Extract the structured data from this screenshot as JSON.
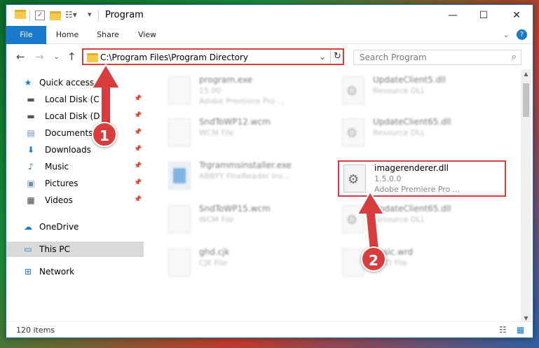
{
  "window": {
    "title": "Program",
    "minimize": "—",
    "maximize": "☐",
    "close": "✕"
  },
  "ribbon": {
    "tabs": [
      "File",
      "Home",
      "Share",
      "View"
    ],
    "expand": "⌄",
    "help": "?"
  },
  "nav": {
    "back": "←",
    "forward": "→",
    "recent": "⌄",
    "up": "↑",
    "address": "C:\\Program Files\\Program Directory",
    "address_chevron": "⌄",
    "refresh": "↻",
    "search_placeholder": "Search Program",
    "search_icon": "⌕"
  },
  "sidebar": {
    "items": [
      {
        "label": "Quick access",
        "icon": "star-icon",
        "glyph": "★"
      },
      {
        "label": "Local Disk (C:)",
        "icon": "drive-icon",
        "glyph": "▬"
      },
      {
        "label": "Local Disk (D:)",
        "icon": "drive-icon",
        "glyph": "▬"
      },
      {
        "label": "Documents",
        "icon": "documents-icon",
        "glyph": "▤"
      },
      {
        "label": "Downloads",
        "icon": "download-icon",
        "glyph": "⬇"
      },
      {
        "label": "Music",
        "icon": "music-icon",
        "glyph": "♪"
      },
      {
        "label": "Pictures",
        "icon": "pictures-icon",
        "glyph": "▣"
      },
      {
        "label": "Videos",
        "icon": "video-icon",
        "glyph": "▦"
      },
      {
        "label": "OneDrive",
        "icon": "cloud-icon",
        "glyph": "☁"
      },
      {
        "label": "This PC",
        "icon": "computer-icon",
        "glyph": "▭"
      },
      {
        "label": "Network",
        "icon": "network-icon",
        "glyph": "⊞"
      }
    ],
    "pin": "📌"
  },
  "files": [
    {
      "name": "program.exe",
      "line1": "15.00",
      "line2": "Adobe Premiere Pro ..."
    },
    {
      "name": "UpdateClient5.dll",
      "line1": "Resource DLL",
      "line2": ""
    },
    {
      "name": "SndToWP12.wcm",
      "line1": "WCM File",
      "line2": ""
    },
    {
      "name": "UpdateClient65.dll",
      "line1": "Resource DLL",
      "line2": ""
    },
    {
      "name": "Trgrammsinstaller.exe",
      "line1": "ABBYY FineReader Ins...",
      "line2": ""
    },
    {
      "name": "imagerenderer.dll",
      "line1": "1.5.0.0",
      "line2": "Adobe Premiere Pro ..."
    },
    {
      "name": "SndToWP15.wcm",
      "line1": "WCM File",
      "line2": ""
    },
    {
      "name": "UpdateClient65.dll",
      "line1": "Resource DLL",
      "line2": ""
    },
    {
      "name": "ghd.cjk",
      "line1": "CJK File",
      "line2": ""
    },
    {
      "name": "basic.wrd",
      "line1": "WRD File",
      "line2": ""
    }
  ],
  "status": {
    "count": "120 items",
    "details_view": "☷",
    "icons_view": "▦"
  },
  "annotations": {
    "badge1": "1",
    "badge2": "2",
    "color": "#d93c3c"
  }
}
